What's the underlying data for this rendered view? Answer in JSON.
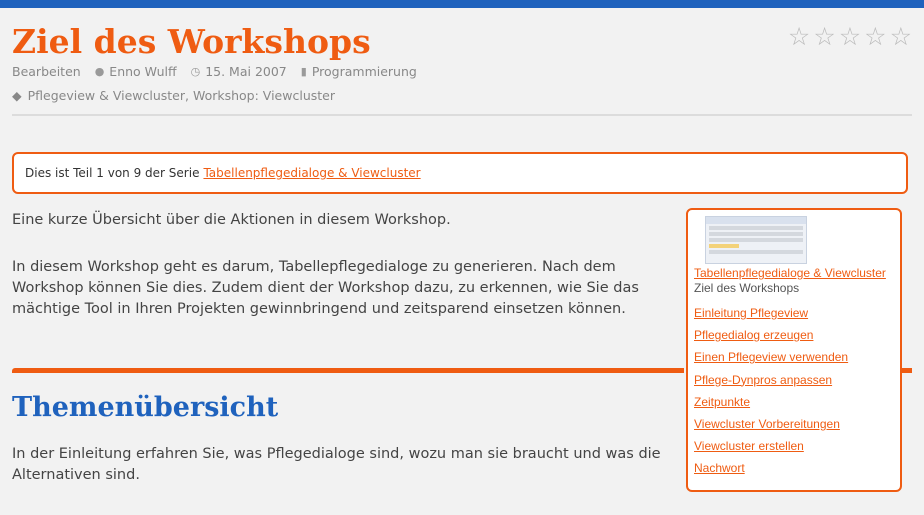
{
  "colors": {
    "accent": "#ef5c12",
    "brand_blue": "#1f62bd",
    "background": "#f2f2f2"
  },
  "post": {
    "title": "Ziel des Workshops",
    "rating_icons": [
      "star-outline-icon",
      "star-outline-icon",
      "star-outline-icon",
      "star-outline-icon",
      "star-outline-icon"
    ],
    "meta": {
      "edit_label": "Bearbeiten",
      "author": "Enno Wulff",
      "date": "15. Mai 2007",
      "category": "Programmierung",
      "tags": "Pflegeview & Viewcluster, Workshop: Viewcluster"
    }
  },
  "series": {
    "prefix": "Dies ist Teil 1 von 9 der Serie",
    "link": "Tabellenpflegedialoge & Viewcluster"
  },
  "content": {
    "intro": "Eine kurze Übersicht über die Aktionen in diesem Workshop.",
    "para2": "In diesem Workshop geht es darum, Tabellepflegedialoge zu generieren. Nach dem Workshop können Sie dies. Zudem dient der Workshop dazu, zu erkennen, wie Sie das mächtige Tool in Ihren Projekten gewinnbringend und zeitsparend einsetzen können.",
    "section_title": "Themenübersicht",
    "para3": "In der Einleitung  erfahren Sie, was Pflegedialoge sind, wozu man sie braucht und was die Alternativen sind."
  },
  "series_nav": {
    "series_link": "Tabellenpflegedialoge & Viewcluster",
    "current": "Ziel des Workshops",
    "items": [
      "Einleitung Pflegeview",
      "Pflegedialog erzeugen",
      "Einen Pflegeview verwenden",
      "Pflege-Dynpros anpassen",
      "Zeitpunkte",
      "Viewcluster Vorbereitungen",
      "Viewcluster erstellen",
      "Nachwort"
    ]
  }
}
